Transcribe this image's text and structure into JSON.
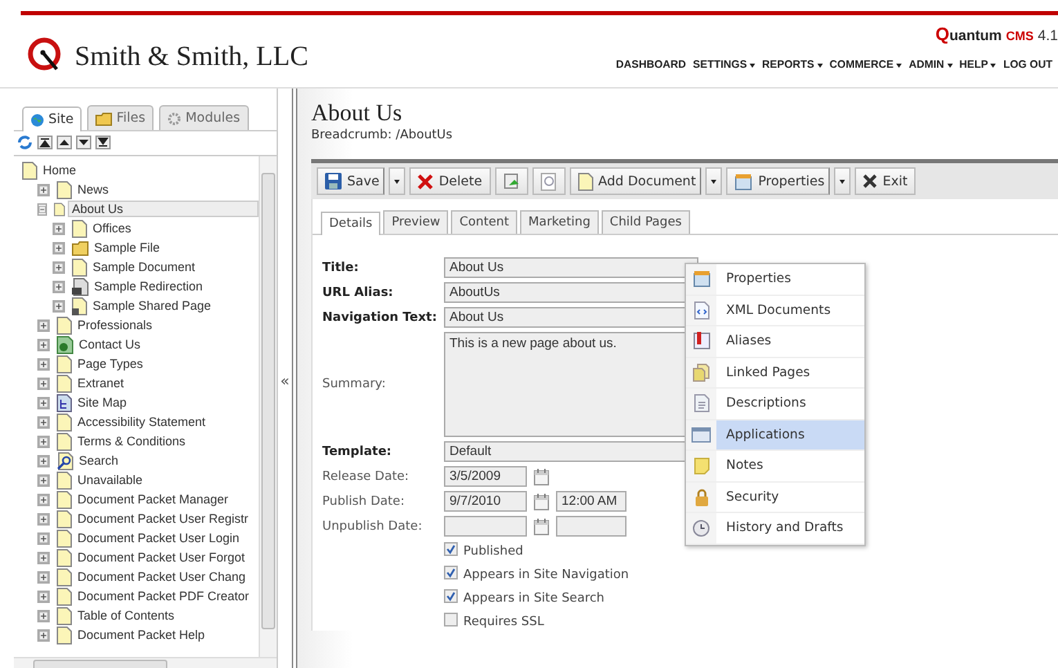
{
  "header": {
    "company": "Smith & Smith, LLC",
    "product": {
      "name": "Quantum",
      "suffix": "CMS",
      "version": "4.1"
    },
    "nav": [
      {
        "label": "DASHBOARD",
        "has_menu": false
      },
      {
        "label": "SETTINGS",
        "has_menu": true
      },
      {
        "label": "REPORTS",
        "has_menu": true
      },
      {
        "label": "COMMERCE",
        "has_menu": true
      },
      {
        "label": "ADMIN",
        "has_menu": true
      },
      {
        "label": "HELP",
        "has_menu": true
      },
      {
        "label": "LOG OUT",
        "has_menu": false
      }
    ]
  },
  "sidebar": {
    "tabs": [
      {
        "label": "Site",
        "selected": true
      },
      {
        "label": "Files",
        "selected": false
      },
      {
        "label": "Modules",
        "selected": false
      }
    ],
    "tree": [
      {
        "label": "Home",
        "kind": "page",
        "selected": false,
        "children": [
          {
            "label": "News",
            "kind": "page",
            "expanded": false,
            "selected": false
          },
          {
            "label": "About Us",
            "kind": "page",
            "expanded": true,
            "selected": true,
            "children": [
              {
                "label": "Offices",
                "kind": "page",
                "expanded": false,
                "selected": false
              },
              {
                "label": "Sample File",
                "kind": "file",
                "expanded": false,
                "selected": false
              },
              {
                "label": "Sample Document",
                "kind": "page",
                "expanded": false,
                "selected": false
              },
              {
                "label": "Sample Redirection",
                "kind": "redirection",
                "expanded": false,
                "selected": false
              },
              {
                "label": "Sample Shared Page",
                "kind": "shared",
                "expanded": false,
                "selected": false
              }
            ]
          },
          {
            "label": "Professionals",
            "kind": "page",
            "expanded": false,
            "selected": false
          },
          {
            "label": "Contact Us",
            "kind": "contact",
            "expanded": false,
            "selected": false
          },
          {
            "label": "Page Types",
            "kind": "page",
            "expanded": false,
            "selected": false
          },
          {
            "label": "Extranet",
            "kind": "page",
            "expanded": false,
            "selected": false
          },
          {
            "label": "Site Map",
            "kind": "sitemap",
            "expanded": false,
            "selected": false
          },
          {
            "label": "Accessibility Statement",
            "kind": "page",
            "expanded": false,
            "selected": false
          },
          {
            "label": "Terms & Conditions",
            "kind": "page",
            "expanded": false,
            "selected": false
          },
          {
            "label": "Search",
            "kind": "search",
            "expanded": false,
            "selected": false
          },
          {
            "label": "Unavailable",
            "kind": "page",
            "expanded": false,
            "selected": false
          },
          {
            "label": "Document Packet Manager",
            "kind": "page",
            "expanded": false,
            "selected": false
          },
          {
            "label": "Document Packet User Registr",
            "kind": "page",
            "expanded": false,
            "selected": false
          },
          {
            "label": "Document Packet User Login",
            "kind": "page",
            "expanded": false,
            "selected": false
          },
          {
            "label": "Document Packet User Forgot",
            "kind": "page",
            "expanded": false,
            "selected": false
          },
          {
            "label": "Document Packet User Chang",
            "kind": "page",
            "expanded": false,
            "selected": false
          },
          {
            "label": "Document Packet PDF Creator",
            "kind": "page",
            "expanded": false,
            "selected": false
          },
          {
            "label": "Table of Contents",
            "kind": "page",
            "expanded": false,
            "selected": false
          },
          {
            "label": "Document Packet Help",
            "kind": "page",
            "expanded": false,
            "selected": false
          }
        ]
      }
    ],
    "collapse_handle": "«"
  },
  "page": {
    "title": "About Us",
    "breadcrumb": "Breadcrumb: /AboutUs",
    "toolbar": [
      {
        "kind": "labeled",
        "label": "Save",
        "split": true
      },
      {
        "kind": "labeled",
        "label": "Delete",
        "split": false
      },
      {
        "kind": "icon",
        "split": false
      },
      {
        "kind": "icon",
        "split": false
      },
      {
        "kind": "labeled",
        "label": "Add Document",
        "split": true
      },
      {
        "kind": "labeled",
        "label": "Properties",
        "split": true
      },
      {
        "kind": "labeled",
        "label": "Exit",
        "split": false
      }
    ],
    "tabs": [
      {
        "label": "Details",
        "selected": true
      },
      {
        "label": "Preview",
        "selected": false
      },
      {
        "label": "Content",
        "selected": false
      },
      {
        "label": "Marketing",
        "selected": false
      },
      {
        "label": "Child Pages",
        "selected": false
      }
    ],
    "fields": [
      {
        "kind": "text",
        "label": "Title:",
        "required": true,
        "value": "About Us"
      },
      {
        "kind": "text",
        "label": "URL Alias:",
        "required": true,
        "value": "AboutUs"
      },
      {
        "kind": "text",
        "label": "Navigation Text:",
        "required": true,
        "value": "About Us"
      },
      {
        "kind": "textarea",
        "label": "Summary:",
        "required": false,
        "value": "This is a new page about us."
      },
      {
        "kind": "select",
        "label": "Template:",
        "required": true,
        "value": "Default"
      },
      {
        "kind": "date",
        "label": "Release Date:",
        "required": false,
        "value": "3/5/2009"
      },
      {
        "kind": "datetime",
        "label": "Publish Date:",
        "required": false,
        "value": "9/7/2010",
        "time": "12:00 AM"
      },
      {
        "kind": "datetime",
        "label": "Unpublish Date:",
        "required": false
      }
    ],
    "checkboxes": [
      {
        "label": "Published",
        "checked": true
      },
      {
        "label": "Appears in Site Navigation",
        "checked": true
      },
      {
        "label": "Appears in Site Search",
        "checked": true
      },
      {
        "label": "Requires SSL",
        "checked": false
      }
    ],
    "properties_menu": [
      {
        "label": "Properties",
        "selected": false
      },
      {
        "label": "XML Documents",
        "selected": false
      },
      {
        "label": "Aliases",
        "selected": false
      },
      {
        "label": "Linked Pages",
        "selected": false
      },
      {
        "label": "Descriptions",
        "selected": false
      },
      {
        "label": "Applications",
        "selected": true
      },
      {
        "label": "Notes",
        "selected": false
      },
      {
        "label": "Security",
        "selected": false
      },
      {
        "label": "History and Drafts",
        "selected": false
      }
    ]
  }
}
